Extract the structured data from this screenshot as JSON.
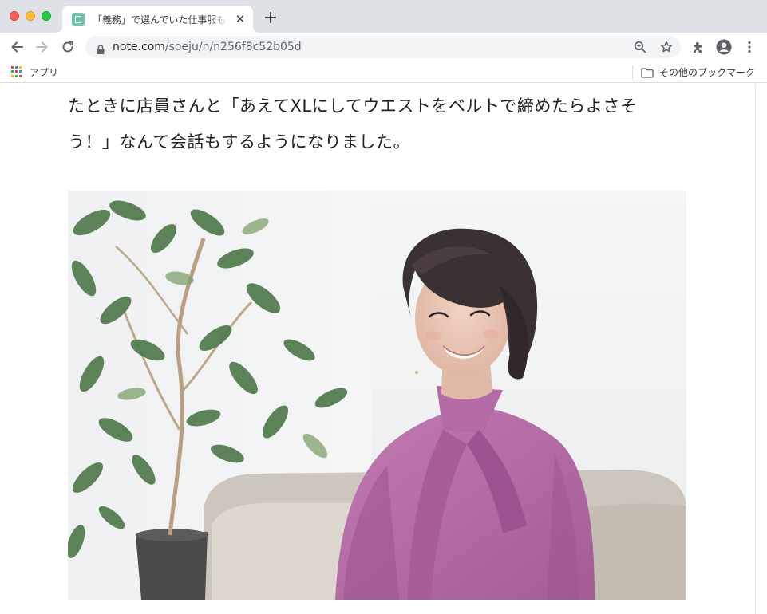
{
  "browser": {
    "tab_title": "「義務」で選んでいた仕事服も",
    "url_host": "note.com",
    "url_path": "/soeju/n/n256f8c52b05d",
    "bookmarks": {
      "apps_label": "アプリ",
      "other_label": "その他のブックマーク"
    }
  },
  "article": {
    "paragraph": "たときに店員さんと「あえてXLにしてウエストをベルトで締めたらよさそう！」なんて会話もするようになりました。",
    "photo_description_icon": "portrait-photo"
  },
  "colors": {
    "tabstrip": "#dee1e6",
    "favicon": "#6fc3ad",
    "blouse": "#b56aa4"
  }
}
